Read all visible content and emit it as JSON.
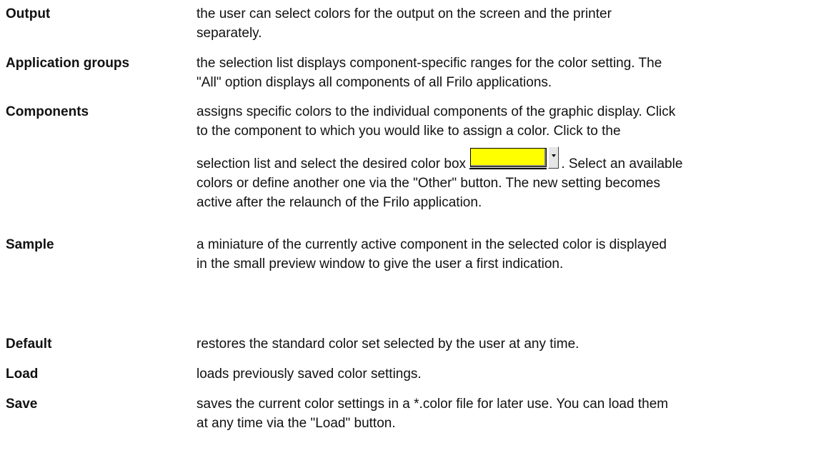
{
  "entries": [
    {
      "term": "Output",
      "lines": [
        "the user can select colors for the output on the screen and the printer",
        "separately."
      ]
    },
    {
      "term": "Application groups",
      "lines": [
        "the selection list displays component-specific ranges for the color setting. The",
        "\"All\" option displays all components of all Frilo applications."
      ]
    },
    {
      "term": "Components",
      "lines": [
        "assigns specific colors to the individual components of the graphic display. Click",
        "to the component to which you would like to assign a color. Click to the"
      ],
      "line_before_box": "selection list and select the desired color box",
      "line_after_box": ". Select an available",
      "more_lines": [
        "colors or define another one via the \"Other\" button. The new setting becomes",
        "active after the relaunch of the Frilo application."
      ]
    },
    {
      "term": "Sample",
      "lines": [
        "a miniature of the currently active component in the selected  color is displayed",
        "in the small preview window to give the user a first indication."
      ]
    },
    {
      "term": "Default",
      "lines": [
        "restores the standard color set selected by the user at any time."
      ]
    },
    {
      "term": "Load",
      "lines": [
        "loads previously saved color settings."
      ]
    },
    {
      "term": "Save",
      "lines": [
        "saves the current color settings in a *.color file for later use. You can load them",
        "at any time via the \"Load\" button."
      ]
    }
  ],
  "color_box": {
    "color": "#ffff00",
    "icon": "dropdown-arrow-icon"
  }
}
